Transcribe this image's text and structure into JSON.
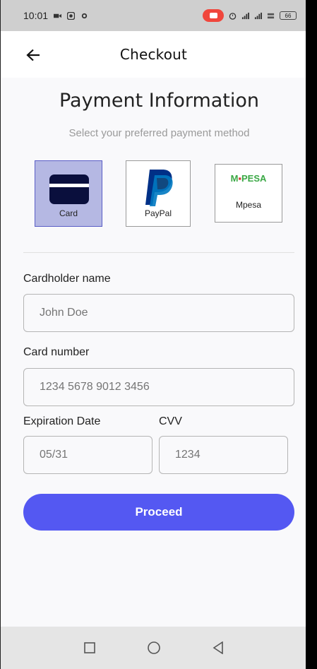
{
  "status_bar": {
    "time": "10:01",
    "battery": "66"
  },
  "app_bar": {
    "title": "Checkout",
    "back_icon": "arrow-left-icon"
  },
  "page": {
    "heading": "Payment Information",
    "subheading": "Select your preferred payment method"
  },
  "payment_methods": [
    {
      "label": "Card",
      "icon": "credit-card-icon",
      "selected": true
    },
    {
      "label": "PayPal",
      "icon": "paypal-logo",
      "selected": false
    },
    {
      "label": "Mpesa",
      "icon": "mpesa-logo",
      "selected": false,
      "logo_text_prefix": "M",
      "logo_text_suffix": "PESA"
    }
  ],
  "form": {
    "cardholder_label": "Cardholder name",
    "cardholder_placeholder": "John Doe",
    "card_number_label": "Card number",
    "card_number_placeholder": "1234 5678 9012 3456",
    "expiration_label": "Expiration Date",
    "expiration_placeholder": "05/31",
    "cvv_label": "CVV",
    "cvv_placeholder": "1234"
  },
  "proceed_label": "Proceed",
  "colors": {
    "accent": "#5458f2",
    "selected_bg": "#b5b8e3",
    "mpesa_green": "#3aa845"
  }
}
